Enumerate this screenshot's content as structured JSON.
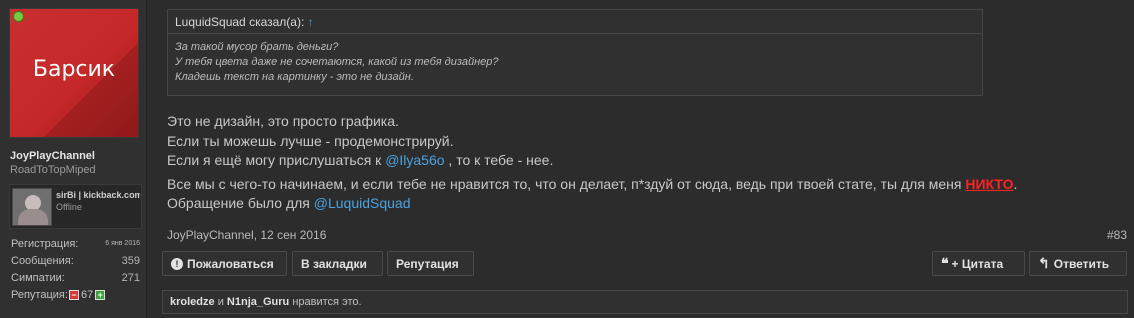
{
  "user": {
    "avatar_text": "Барсик",
    "name": "JoyPlayChannel",
    "title": "RoadToTopMiped",
    "online_color": "#7ac943",
    "status_bar": {
      "name": "sirBi | kickback.com",
      "status": "Offline"
    },
    "stats": {
      "registration_label": "Регистрация:",
      "registration_value": "6 янв 2016",
      "messages_label": "Сообщения:",
      "messages_value": "359",
      "likes_label": "Симпатии:",
      "likes_value": "271",
      "reputation_label": "Репутация:",
      "reputation_value": "67"
    }
  },
  "quote": {
    "author": "LuquidSquad сказал(а):",
    "arrow_icon": "↑",
    "lines": [
      "За такой мусор брать деньги?",
      "У тебя цвета даже не сочетаются, какой из тебя дизайнер?",
      "Кладешь текст на картинку - это не дизайн."
    ]
  },
  "message": {
    "line1": "Это не дизайн, это просто графика.",
    "line2": "Если ты можешь лучше - продемонстрируй.",
    "line3_pre": "Если я ещё могу прислушаться к ",
    "line3_mention": "@Ilya56o",
    "line3_post": " , то к тебе - нее.",
    "line4_pre": "Все мы с чего-то начинаем, и если тебе не нравится то, что он делает, п*здуй от сюда, ведь при твоей стате, ты для меня ",
    "line4_highlight": "НИКТО",
    "line4_post": ".",
    "line5_pre": "Обращение было для ",
    "line5_mention": "@LuquidSquad",
    "mention_color": "#4aa3df",
    "highlight_color": "#ff2222"
  },
  "meta": {
    "author_date": "JoyPlayChannel, 12 сен 2016",
    "post_number": "#83"
  },
  "actions": {
    "report": "Пожаловаться",
    "bookmark": "В закладки",
    "reputation": "Репутация",
    "quote": "+ Цитата",
    "reply": "Ответить"
  },
  "likes": {
    "user1": "kroledze",
    "and": "и",
    "user2": "N1nja_Guru",
    "suffix": "нравится это."
  }
}
